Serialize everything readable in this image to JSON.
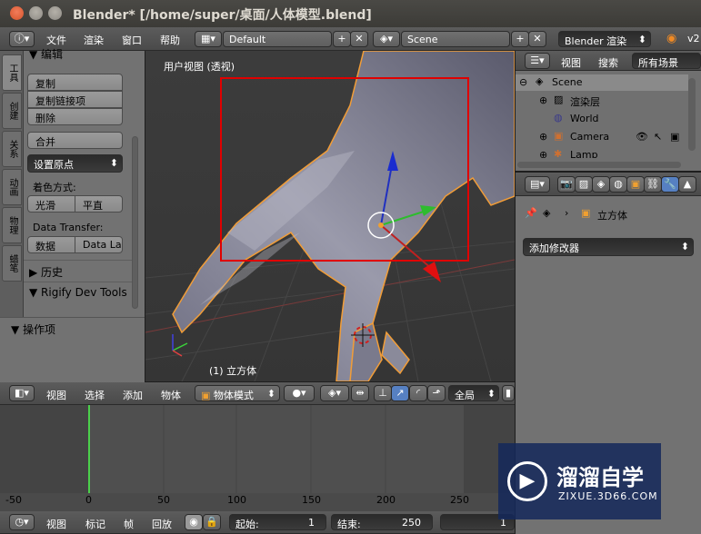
{
  "window": {
    "title": "Blender* [/home/super/桌面/人体模型.blend]"
  },
  "colors": {
    "close": "#e0603b",
    "minimize": "#9e9a93",
    "maximize": "#9e9a93",
    "selection_red": "#e00000",
    "active_blue": "#5680c2"
  },
  "info_header": {
    "menus": [
      "文件",
      "渲染",
      "窗口",
      "帮助"
    ],
    "layout": "Default",
    "scene": "Scene",
    "engine": "Blender 渲染",
    "version": "v2"
  },
  "tool_tabs": [
    "工具",
    "创建",
    "关系",
    "动画",
    "物理",
    "蜡笔"
  ],
  "tool_shelf": {
    "section": "编辑",
    "buttons": [
      "复制",
      "复制链接项",
      "删除"
    ],
    "join": "合并",
    "set_origin": "设置原点",
    "shading_label": "着色方式:",
    "smooth": "光滑",
    "flat": "平直",
    "data_transfer_label": "Data Transfer:",
    "data": "数据",
    "data_layers": "Data La",
    "history": "历史",
    "rigify": "Rigify Dev Tools",
    "operator": "操作项"
  },
  "viewport": {
    "view_label": "用户视图 (透视)",
    "object_label": "(1) 立方体"
  },
  "view3d_header": {
    "menus": [
      "视图",
      "选择",
      "添加",
      "物体"
    ],
    "mode": "物体模式",
    "pivot": "全局"
  },
  "timeline": {
    "ticks": [
      "-50",
      "0",
      "50",
      "100",
      "150",
      "200",
      "250"
    ],
    "current_frame": 1
  },
  "timeline_header": {
    "menus": [
      "视图",
      "标记",
      "帧",
      "回放"
    ],
    "start_label": "起始:",
    "start_value": "1",
    "end_label": "结束:",
    "end_value": "250",
    "current": "1"
  },
  "outliner": {
    "menus": [
      "视图",
      "搜索"
    ],
    "filter": "所有场景",
    "items": [
      "Scene",
      "渲染层",
      "World",
      "Camera",
      "Lamp"
    ]
  },
  "properties": {
    "object_name": "立方体",
    "add_modifier": "添加修改器"
  },
  "watermark": {
    "title": "溜溜自学",
    "url": "ZIXUE.3D66.COM"
  }
}
